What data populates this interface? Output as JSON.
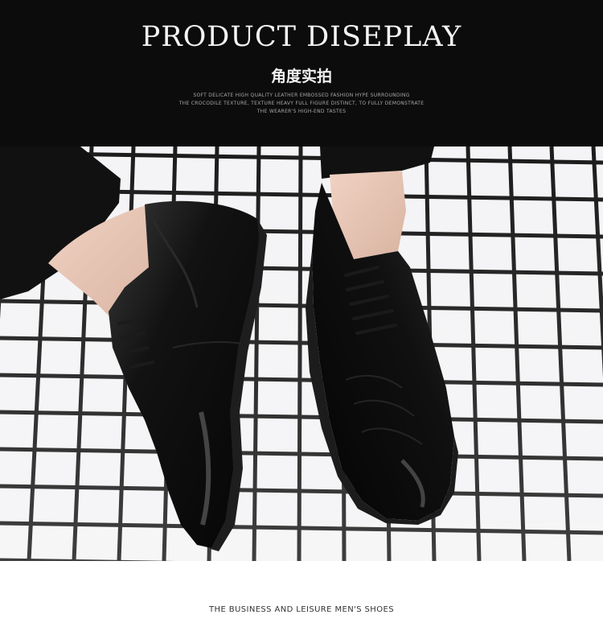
{
  "header": {
    "title": "PRODUCT DISEPLAY",
    "subtitle": "角度实拍",
    "description_lines": [
      "SOFT DELICATE HIGH QUALITY LEATHER  EMBOSSED FASHION HYPE SURROUNDING",
      "THE CROCODILE TEXTURE, TEXTURE HEAVY FULL FIGURE  DISTINCT, TO FULLY DEMONSTRATE",
      "THE WEARER'S HIGH-END TASTES"
    ]
  },
  "photo": {
    "subject": "black-leather-derby-shoes-icon"
  },
  "footer": {
    "caption": "THE BUSINESS AND LEISURE MEN'S SHOES"
  },
  "colors": {
    "header_bg": "#0c0c0c",
    "tile_white": "#f6f6f8",
    "grout": "#1a1a1a",
    "shoe_black": "#0b0b0b"
  }
}
